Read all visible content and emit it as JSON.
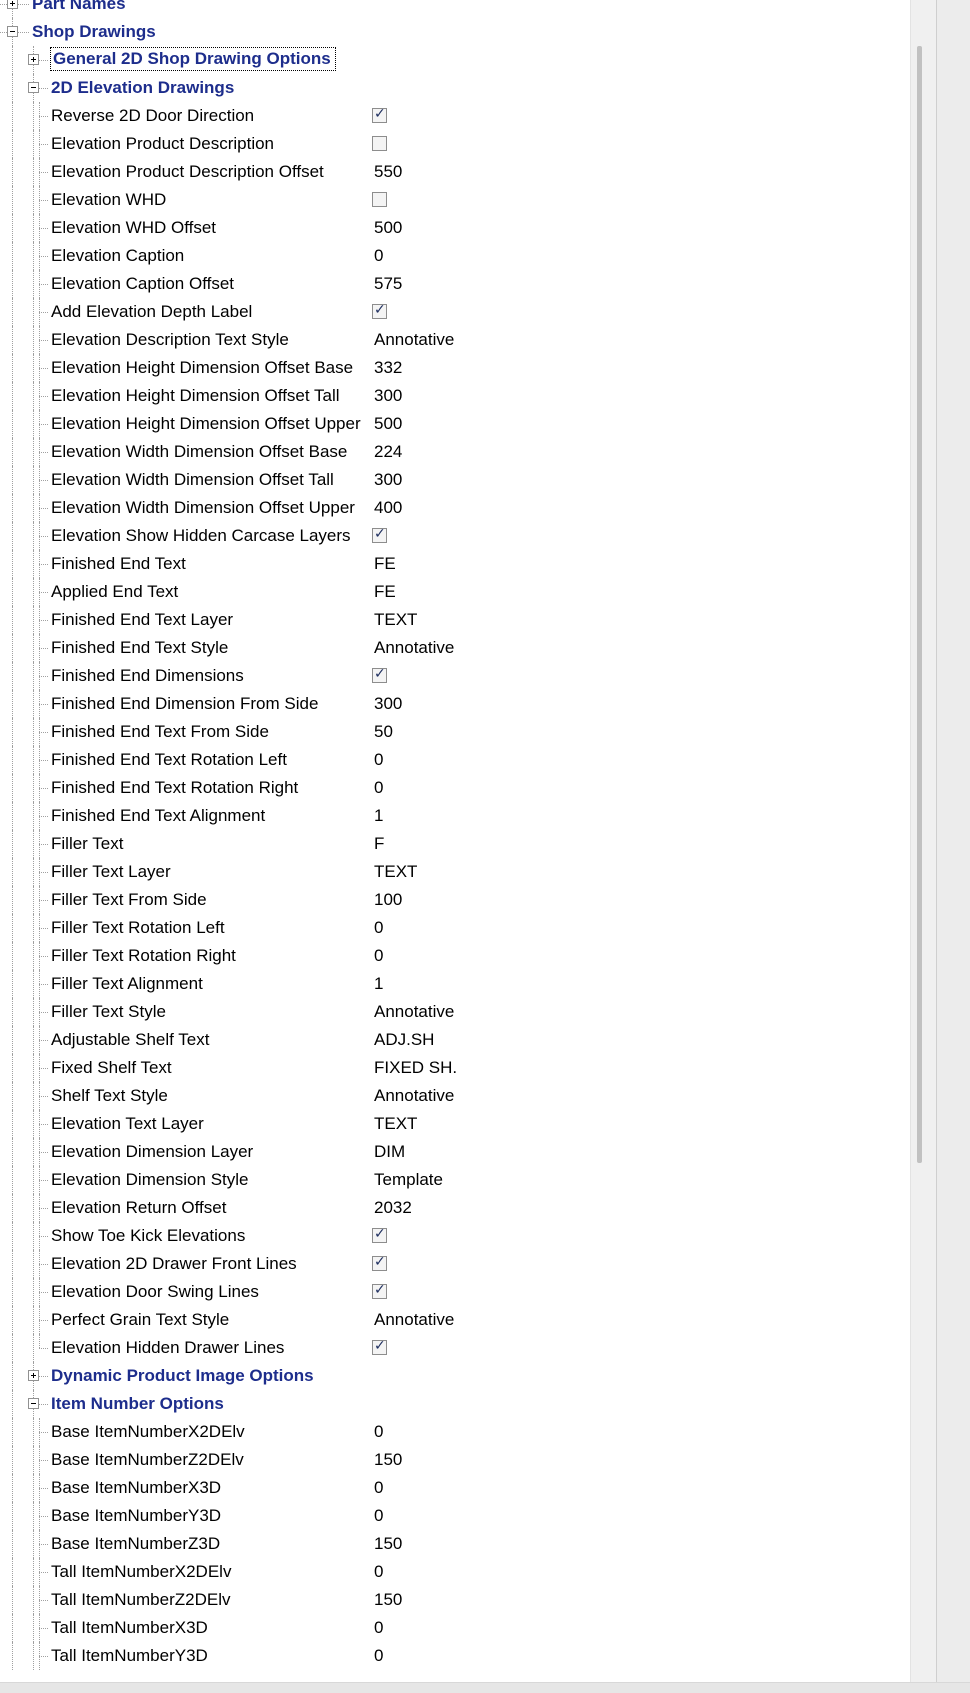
{
  "tree": {
    "rows": [
      {
        "level": 0,
        "type": "category",
        "label": "Part Names",
        "expanded": false
      },
      {
        "level": 0,
        "type": "category",
        "label": "Shop Drawings",
        "expanded": true
      },
      {
        "level": 1,
        "type": "category",
        "label": "General 2D Shop Drawing Options",
        "expanded": false,
        "focused": true
      },
      {
        "level": 1,
        "type": "category",
        "label": "2D Elevation Drawings",
        "expanded": true
      },
      {
        "level": 2,
        "type": "check",
        "label": "Reverse 2D Door Direction",
        "checked": true
      },
      {
        "level": 2,
        "type": "check",
        "label": "Elevation Product Description",
        "checked": false
      },
      {
        "level": 2,
        "type": "value",
        "label": "Elevation Product Description Offset",
        "value": "550"
      },
      {
        "level": 2,
        "type": "check",
        "label": "Elevation WHD",
        "checked": false
      },
      {
        "level": 2,
        "type": "value",
        "label": "Elevation WHD Offset",
        "value": "500"
      },
      {
        "level": 2,
        "type": "value",
        "label": "Elevation Caption",
        "value": "0"
      },
      {
        "level": 2,
        "type": "value",
        "label": "Elevation Caption Offset",
        "value": "575"
      },
      {
        "level": 2,
        "type": "check",
        "label": "Add Elevation Depth Label",
        "checked": true
      },
      {
        "level": 2,
        "type": "value",
        "label": "Elevation Description Text Style",
        "value": "Annotative"
      },
      {
        "level": 2,
        "type": "value",
        "label": "Elevation Height Dimension Offset Base",
        "value": "332"
      },
      {
        "level": 2,
        "type": "value",
        "label": "Elevation Height Dimension Offset Tall",
        "value": "300"
      },
      {
        "level": 2,
        "type": "value",
        "label": "Elevation Height Dimension Offset Upper",
        "value": "500"
      },
      {
        "level": 2,
        "type": "value",
        "label": "Elevation Width Dimension Offset Base",
        "value": "224"
      },
      {
        "level": 2,
        "type": "value",
        "label": "Elevation Width Dimension Offset Tall",
        "value": "300"
      },
      {
        "level": 2,
        "type": "value",
        "label": "Elevation Width Dimension Offset Upper",
        "value": "400"
      },
      {
        "level": 2,
        "type": "check",
        "label": "Elevation Show Hidden Carcase Layers",
        "checked": true
      },
      {
        "level": 2,
        "type": "value",
        "label": "Finished End Text",
        "value": "FE"
      },
      {
        "level": 2,
        "type": "value",
        "label": "Applied End Text",
        "value": "FE"
      },
      {
        "level": 2,
        "type": "value",
        "label": "Finished End Text Layer",
        "value": "TEXT"
      },
      {
        "level": 2,
        "type": "value",
        "label": "Finished End Text Style",
        "value": "Annotative"
      },
      {
        "level": 2,
        "type": "check",
        "label": "Finished End Dimensions",
        "checked": true
      },
      {
        "level": 2,
        "type": "value",
        "label": "Finished End Dimension From Side",
        "value": "300"
      },
      {
        "level": 2,
        "type": "value",
        "label": "Finished End Text From Side",
        "value": "50"
      },
      {
        "level": 2,
        "type": "value",
        "label": "Finished End Text Rotation Left",
        "value": "0"
      },
      {
        "level": 2,
        "type": "value",
        "label": "Finished End Text Rotation Right",
        "value": "0"
      },
      {
        "level": 2,
        "type": "value",
        "label": "Finished End Text Alignment",
        "value": "1"
      },
      {
        "level": 2,
        "type": "value",
        "label": "Filler Text",
        "value": "F"
      },
      {
        "level": 2,
        "type": "value",
        "label": "Filler Text Layer",
        "value": "TEXT"
      },
      {
        "level": 2,
        "type": "value",
        "label": "Filler Text From Side",
        "value": "100"
      },
      {
        "level": 2,
        "type": "value",
        "label": "Filler Text Rotation Left",
        "value": "0"
      },
      {
        "level": 2,
        "type": "value",
        "label": "Filler Text Rotation Right",
        "value": "0"
      },
      {
        "level": 2,
        "type": "value",
        "label": "Filler Text Alignment",
        "value": "1"
      },
      {
        "level": 2,
        "type": "value",
        "label": "Filler Text Style",
        "value": "Annotative"
      },
      {
        "level": 2,
        "type": "value",
        "label": "Adjustable Shelf Text",
        "value": "ADJ.SH"
      },
      {
        "level": 2,
        "type": "value",
        "label": "Fixed Shelf Text",
        "value": "FIXED SH."
      },
      {
        "level": 2,
        "type": "value",
        "label": "Shelf Text Style",
        "value": "Annotative"
      },
      {
        "level": 2,
        "type": "value",
        "label": "Elevation Text Layer",
        "value": "TEXT"
      },
      {
        "level": 2,
        "type": "value",
        "label": "Elevation Dimension Layer",
        "value": "DIM"
      },
      {
        "level": 2,
        "type": "value",
        "label": "Elevation Dimension Style",
        "value": "Template"
      },
      {
        "level": 2,
        "type": "value",
        "label": "Elevation Return Offset",
        "value": "2032"
      },
      {
        "level": 2,
        "type": "check",
        "label": "Show Toe Kick Elevations",
        "checked": true
      },
      {
        "level": 2,
        "type": "check",
        "label": "Elevation 2D Drawer Front Lines",
        "checked": true
      },
      {
        "level": 2,
        "type": "check",
        "label": "Elevation Door Swing Lines",
        "checked": true
      },
      {
        "level": 2,
        "type": "value",
        "label": "Perfect Grain Text Style",
        "value": "Annotative"
      },
      {
        "level": 2,
        "type": "check",
        "label": "Elevation Hidden Drawer Lines",
        "checked": true
      },
      {
        "level": 1,
        "type": "category",
        "label": "Dynamic Product Image Options",
        "expanded": false
      },
      {
        "level": 1,
        "type": "category",
        "label": "Item Number Options",
        "expanded": true
      },
      {
        "level": 2,
        "type": "value",
        "label": "Base ItemNumberX2DElv",
        "value": "0"
      },
      {
        "level": 2,
        "type": "value",
        "label": "Base ItemNumberZ2DElv",
        "value": "150"
      },
      {
        "level": 2,
        "type": "value",
        "label": "Base ItemNumberX3D",
        "value": "0"
      },
      {
        "level": 2,
        "type": "value",
        "label": "Base ItemNumberY3D",
        "value": "0"
      },
      {
        "level": 2,
        "type": "value",
        "label": "Base ItemNumberZ3D",
        "value": "150"
      },
      {
        "level": 2,
        "type": "value",
        "label": "Tall ItemNumberX2DElv",
        "value": "0"
      },
      {
        "level": 2,
        "type": "value",
        "label": "Tall ItemNumberZ2DElv",
        "value": "150"
      },
      {
        "level": 2,
        "type": "value",
        "label": "Tall ItemNumberX3D",
        "value": "0"
      },
      {
        "level": 2,
        "type": "value",
        "label": "Tall ItemNumberY3D",
        "value": "0"
      }
    ]
  }
}
